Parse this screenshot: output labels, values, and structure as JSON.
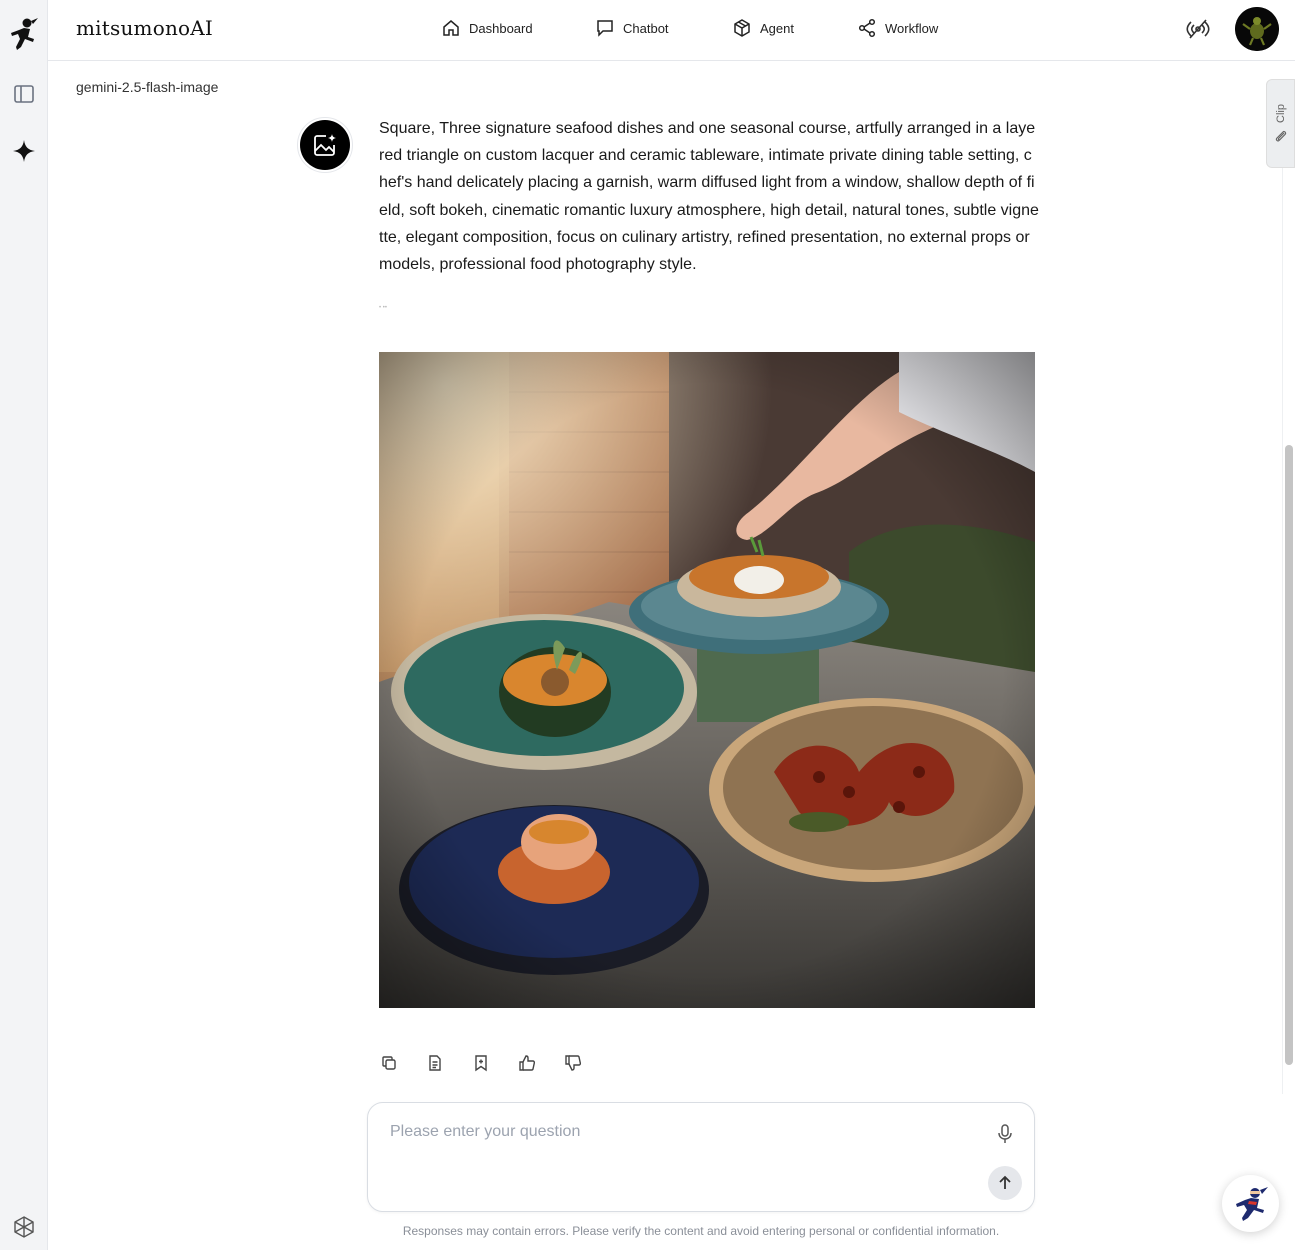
{
  "app": {
    "brand": "mitsumonoAI"
  },
  "nav": {
    "dashboard": "Dashboard",
    "chatbot": "Chatbot",
    "agent": "Agent",
    "workflow": "Workflow"
  },
  "chat": {
    "model": "gemini-2.5-flash-image",
    "prompt": "Square, Three signature seafood dishes and one seasonal course, artfully arranged in a layered triangle on custom lacquer and ceramic tableware, intimate private dining table setting, chef's hand delicately placing a garnish, warm diffused light from a window, shallow depth of field, soft bokeh, cinematic romantic luxury atmosphere, high detail, natural tones, subtle vignette, elegant composition, focus on culinary artistry, refined presentation, no external props or models, professional food photography style."
  },
  "input": {
    "placeholder": "Please enter your question",
    "disclaimer": "Responses may contain errors. Please verify the content and avoid entering personal or confidential information."
  },
  "clip": {
    "label": "Clip"
  },
  "icons": {
    "sidebar": [
      "ninja-logo-icon",
      "panel-toggle-icon",
      "sparkle-icon",
      "cube-network-icon"
    ],
    "nav": [
      "home-icon",
      "chat-bubble-icon",
      "box-icon",
      "share-nodes-icon"
    ],
    "actions": [
      "copy-icon",
      "document-icon",
      "bookmark-icon",
      "thumbs-up-icon",
      "thumbs-down-icon"
    ]
  }
}
